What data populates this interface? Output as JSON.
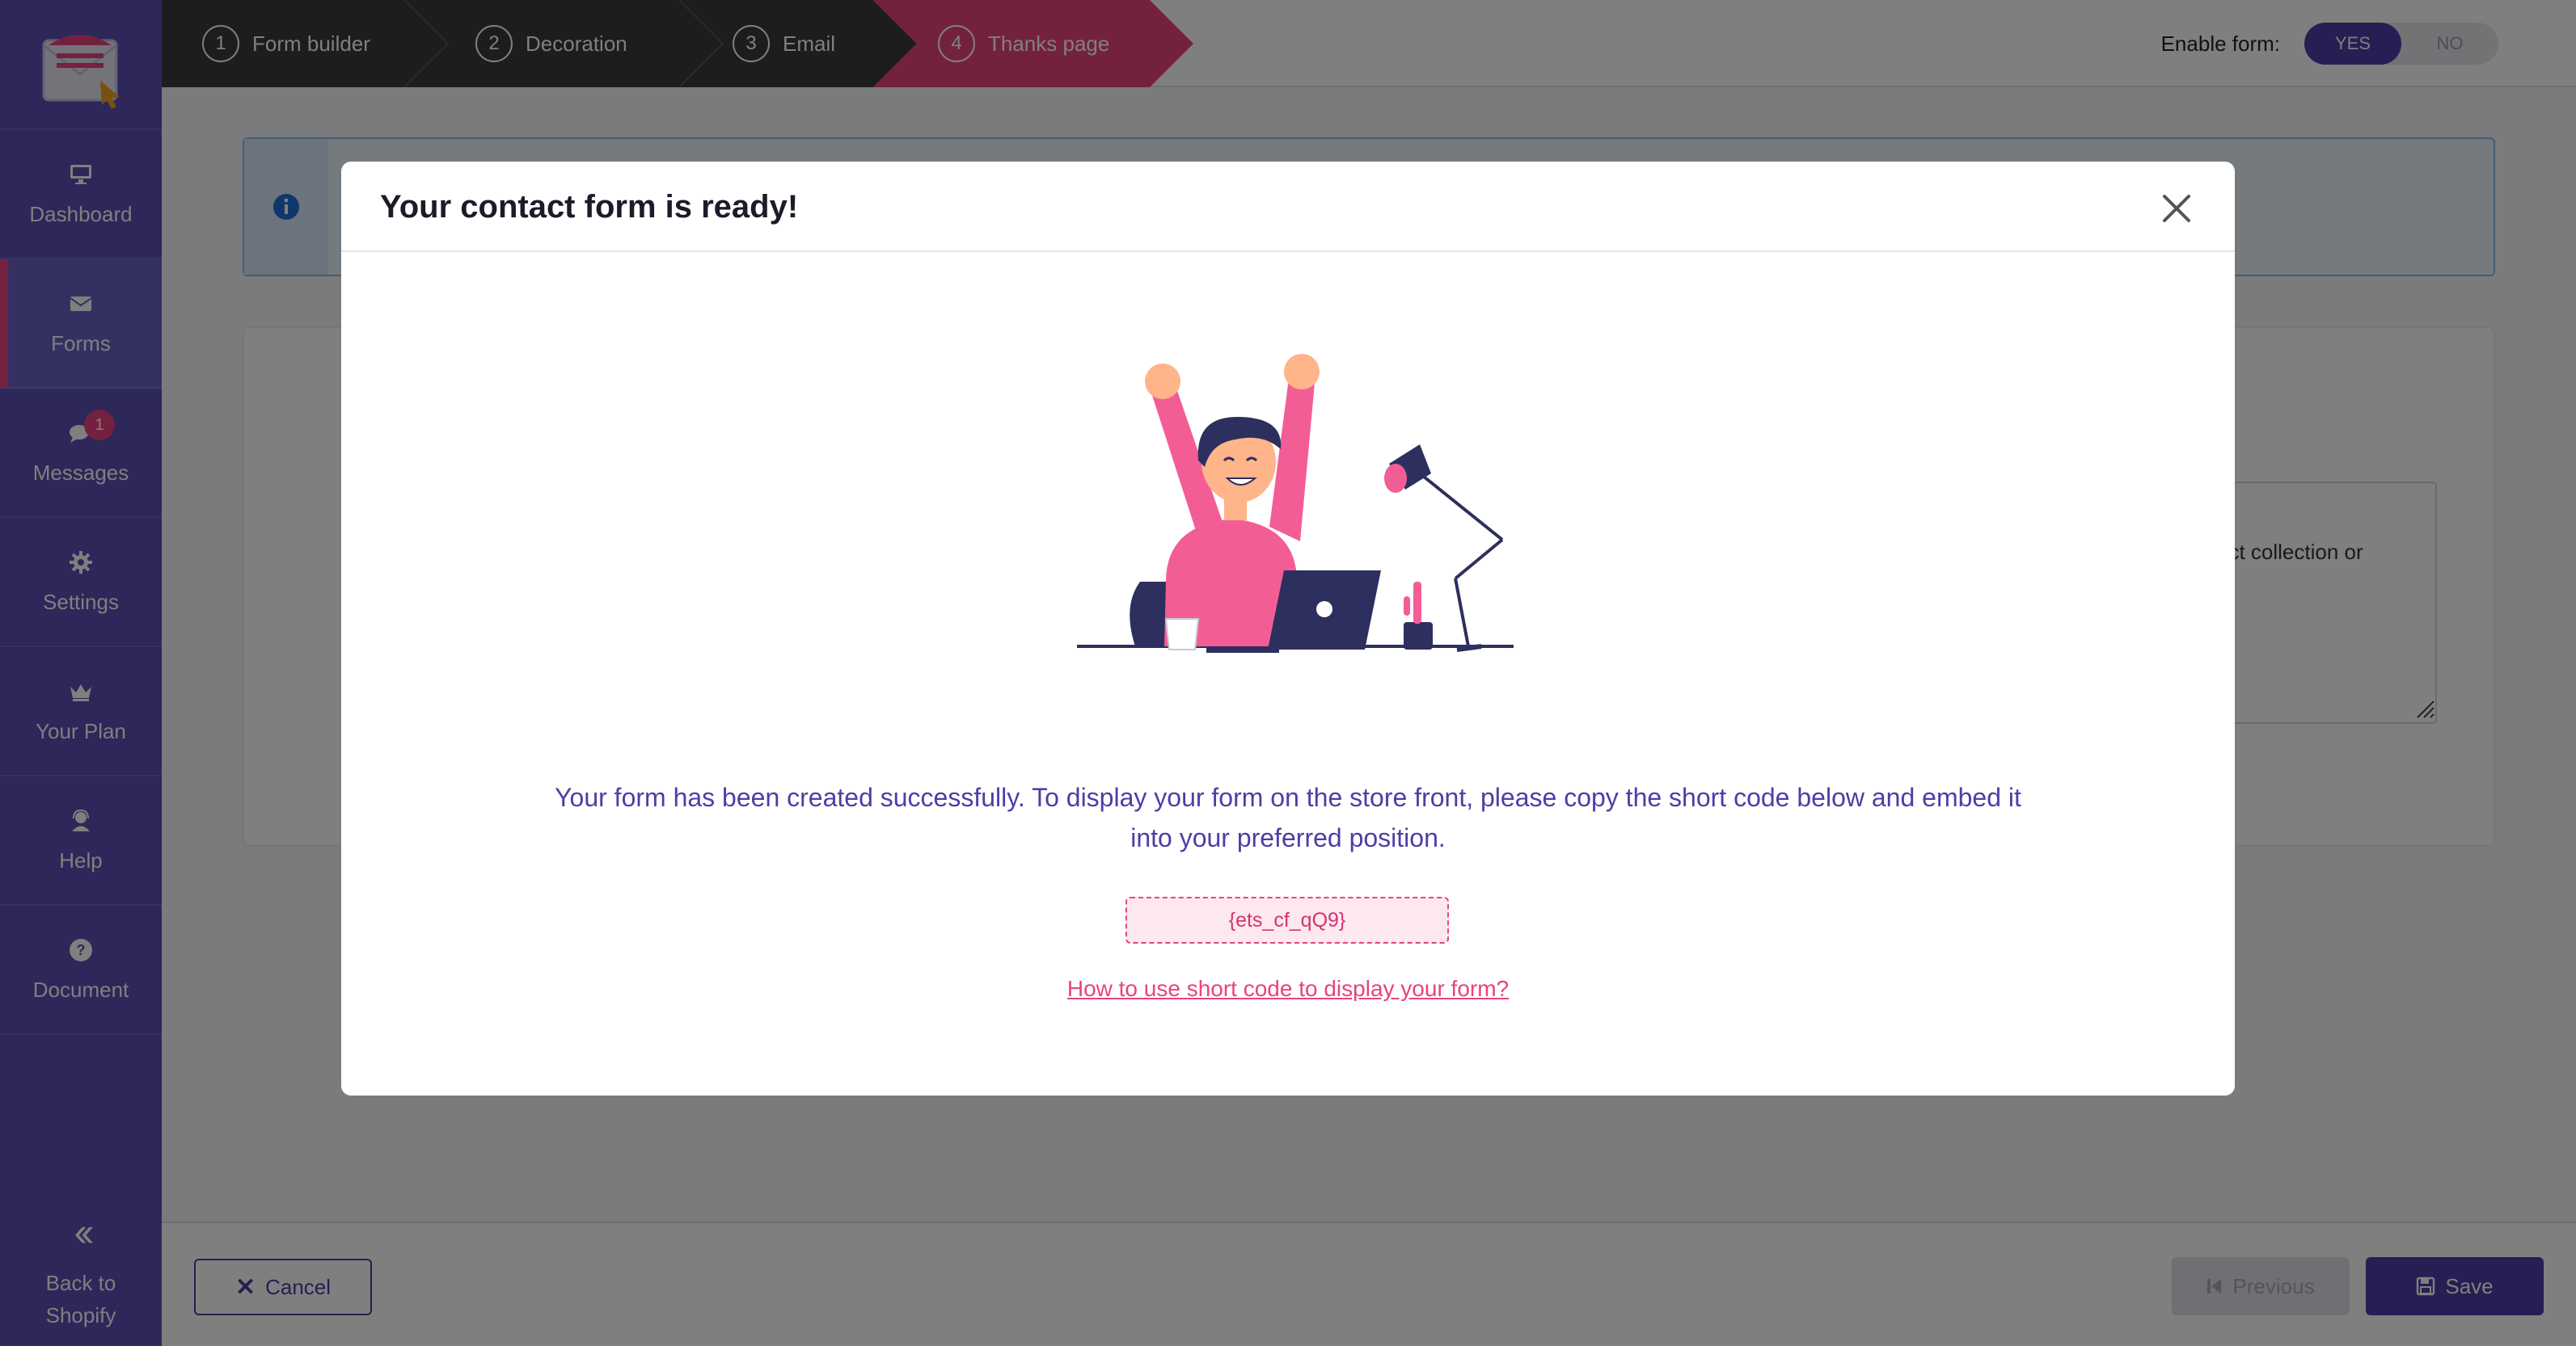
{
  "sidebar": {
    "items": [
      {
        "label": "Dashboard",
        "icon": "desktop-icon"
      },
      {
        "label": "Forms",
        "icon": "envelope-icon"
      },
      {
        "label": "Messages",
        "icon": "chat-icon",
        "badge": "1"
      },
      {
        "label": "Settings",
        "icon": "gear-icon"
      },
      {
        "label": "Your Plan",
        "icon": "crown-icon"
      },
      {
        "label": "Help",
        "icon": "support-agent-icon"
      },
      {
        "label": "Document",
        "icon": "question-circle-icon"
      }
    ],
    "back": {
      "line1": "Back to",
      "line2": "Shopify",
      "icon": "double-chevron-left-icon"
    }
  },
  "steps": [
    {
      "num": "1",
      "label": "Form builder"
    },
    {
      "num": "2",
      "label": "Decoration"
    },
    {
      "num": "3",
      "label": "Email"
    },
    {
      "num": "4",
      "label": "Thanks page"
    }
  ],
  "enable_form": {
    "label": "Enable form:",
    "yes": "YES",
    "no": "NO",
    "selected": "YES"
  },
  "background": {
    "textarea_snippet": "uct collection or"
  },
  "modal": {
    "title": "Your contact form is ready!",
    "message": "Your form has been created successfully. To display your form on the store front, please copy the short code below and embed it into your preferred position.",
    "shortcode": "{ets_cf_qQ9}",
    "howto_link": "How to use short code to display your form?"
  },
  "footer": {
    "cancel_label": "Cancel",
    "previous_label": "Previous",
    "save_label": "Save"
  },
  "colors": {
    "sidebar": "#5b4fb5",
    "accent_pink": "#e8437f",
    "primary": "#4b3fa6",
    "step_dark": "#3a3a3e"
  }
}
